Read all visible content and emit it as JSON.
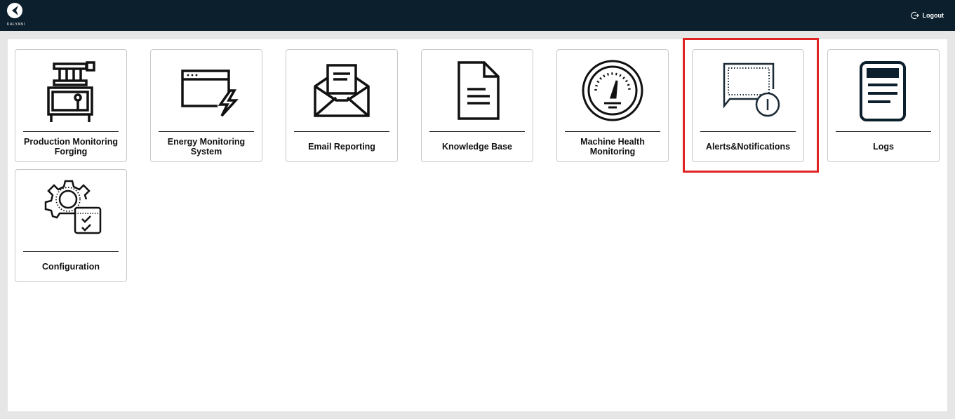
{
  "header": {
    "brand": "KALYANI",
    "logout_label": "Logout",
    "background": "#0c1f2c"
  },
  "tiles": [
    {
      "label": "Production Monitoring Forging",
      "icon": "forging-press-icon"
    },
    {
      "label": "Energy Monitoring System",
      "icon": "energy-window-icon"
    },
    {
      "label": "Email Reporting",
      "icon": "envelope-icon"
    },
    {
      "label": "Knowledge Base",
      "icon": "document-icon"
    },
    {
      "label": "Machine Health Monitoring",
      "icon": "gauge-icon"
    },
    {
      "label": "Alerts&Notifications",
      "icon": "alert-message-icon"
    },
    {
      "label": "Logs",
      "icon": "logs-icon"
    },
    {
      "label": "Configuration",
      "icon": "gear-checklist-icon"
    }
  ],
  "highlight": {
    "target": "Alerts&Notifications",
    "color": "#e02424"
  },
  "icon_color": "#0c1f2c"
}
